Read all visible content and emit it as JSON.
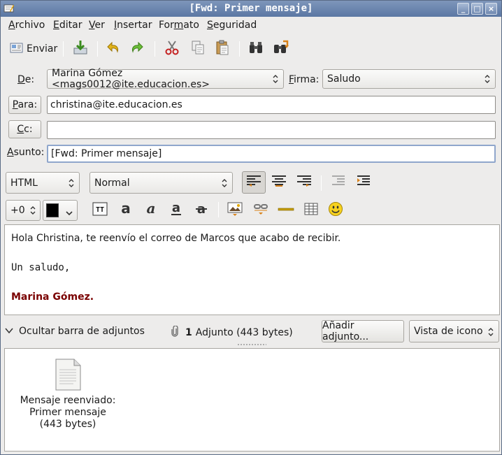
{
  "window": {
    "title": "[Fwd: Primer mensaje]"
  },
  "menu": {
    "items": [
      {
        "label": "Archivo",
        "u": "A",
        "rest": "rchivo"
      },
      {
        "label": "Editar",
        "u": "E",
        "rest": "ditar"
      },
      {
        "label": "Ver",
        "u": "V",
        "rest": "er"
      },
      {
        "label": "Insertar",
        "u": "I",
        "rest": "nsertar"
      },
      {
        "label": "Formato",
        "pre": "For",
        "u": "m",
        "rest": "ato"
      },
      {
        "label": "Seguridad",
        "u": "S",
        "rest": "eguridad"
      }
    ]
  },
  "toolbar": {
    "send_label": "Enviar"
  },
  "header": {
    "from_label": "De:",
    "from_value": "Marina Gómez <mags0012@ite.educacion.es>",
    "signature_label": "Firma:",
    "signature_value": "Saludo",
    "to_button": "Para:",
    "to_value": "christina@ite.educacion.es",
    "cc_button": "Cc:",
    "cc_value": "",
    "subject_label": "Asunto:",
    "subject_value": "[Fwd: Primer mensaje]"
  },
  "format": {
    "mode": "HTML",
    "paragraph_style": "Normal",
    "font_size": "+0",
    "text_color": "#000000"
  },
  "message": {
    "line1": "Hola Christina, te reenvío el correo de Marcos que acabo de recibir.",
    "line2": "Un saludo,",
    "line3": "Marina Gómez.",
    "signature_color": "#7a0000"
  },
  "attachments": {
    "toggle_label": "Ocultar barra de adjuntos",
    "count": "1",
    "summary": "Adjunto (443 bytes)",
    "add_button": "Añadir adjunto...",
    "view_mode": "Vista de icono",
    "items": [
      {
        "line1": "Mensaje reenviado:",
        "line2": "Primer mensaje",
        "line3": "(443 bytes)"
      }
    ]
  }
}
